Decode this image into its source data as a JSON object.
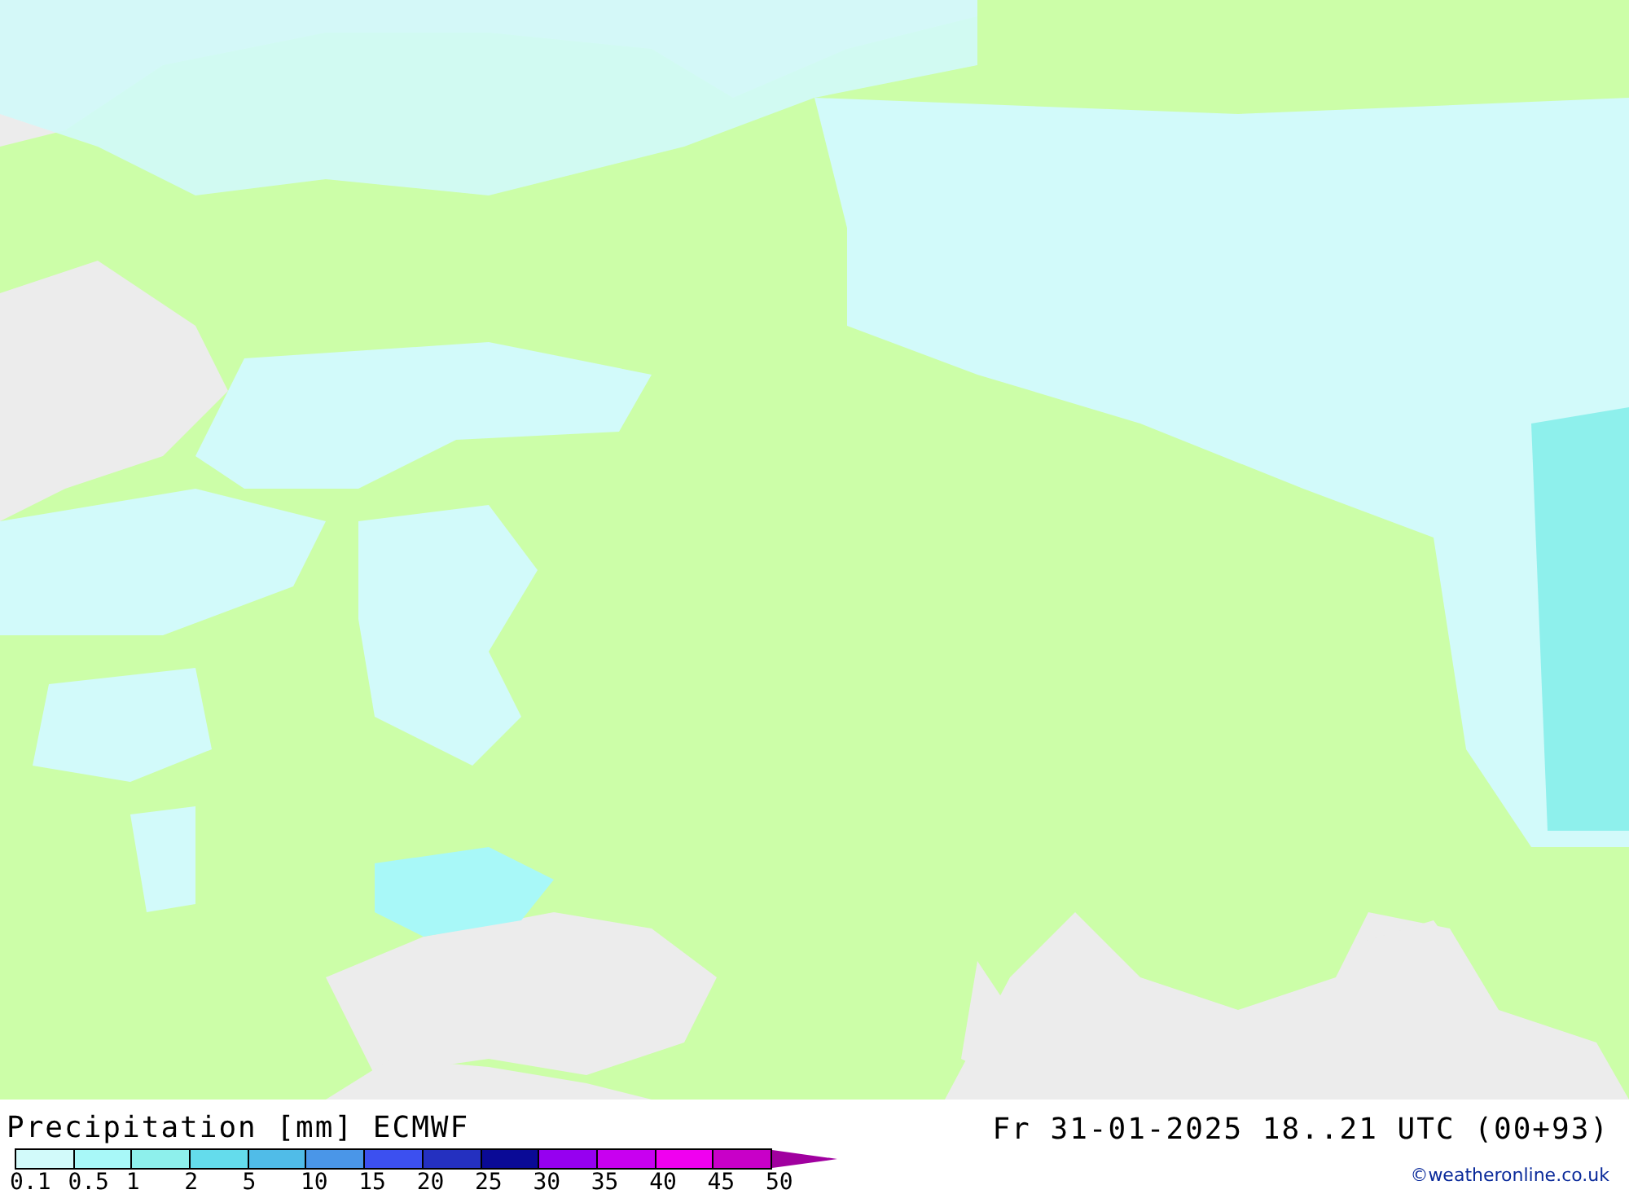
{
  "title": "Precipitation [mm] ECMWF",
  "valid_time": "Fr 31-01-2025 18..21 UTC (00+93)",
  "legend": {
    "items": [
      {
        "label": "0.1",
        "color": "#d2fafa"
      },
      {
        "label": "0.5",
        "color": "#a8f8f8"
      },
      {
        "label": "1",
        "color": "#8ef0ec"
      },
      {
        "label": "2",
        "color": "#64dcec"
      },
      {
        "label": "5",
        "color": "#50bce8"
      },
      {
        "label": "10",
        "color": "#4a96e8"
      },
      {
        "label": "15",
        "color": "#3c50f0"
      },
      {
        "label": "20",
        "color": "#2430c0"
      },
      {
        "label": "25",
        "color": "#0a0a96"
      },
      {
        "label": "30",
        "color": "#9600f0"
      },
      {
        "label": "35",
        "color": "#c800f0"
      },
      {
        "label": "40",
        "color": "#f000f0"
      },
      {
        "label": "45",
        "color": "#c800c8"
      },
      {
        "label": "50",
        "color": "#a0009f",
        "kind": "arrow"
      }
    ]
  },
  "credit": "©weatheronline.co.uk"
}
